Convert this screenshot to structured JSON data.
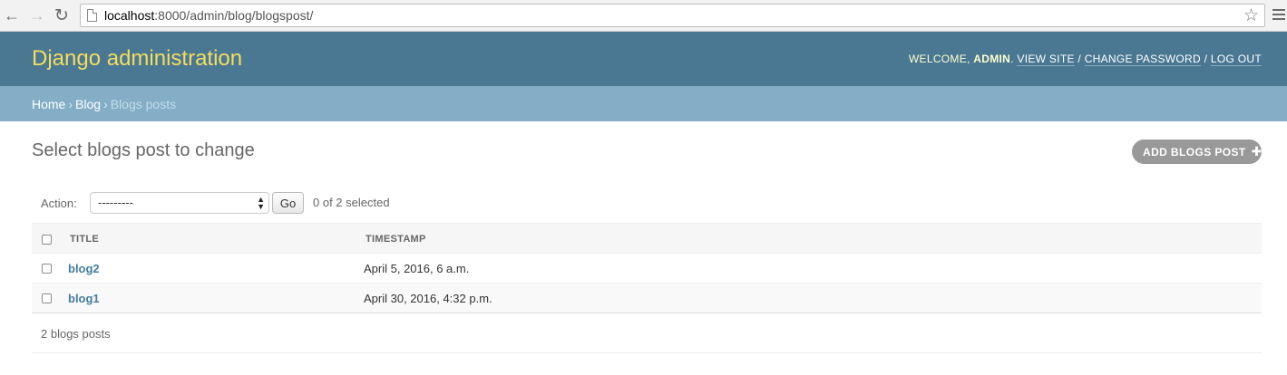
{
  "browser": {
    "url_host": "localhost",
    "url_rest": ":8000/admin/blog/blogspost/",
    "back_icon": "←",
    "forward_icon": "→",
    "reload_icon": "↻",
    "star_icon": "☆"
  },
  "header": {
    "brand": "Django administration",
    "welcome": "WELCOME, ",
    "username": "ADMIN",
    "after_username": ". ",
    "view_site": "VIEW SITE",
    "change_password": "CHANGE PASSWORD",
    "log_out": "LOG OUT",
    "separator": " / "
  },
  "breadcrumbs": {
    "home": "Home",
    "app": "Blog",
    "current": "Blogs posts",
    "arrow": "›"
  },
  "content": {
    "title": "Select blogs post to change",
    "add_button": "ADD BLOGS POST",
    "add_icon": "✚"
  },
  "actions": {
    "label": "Action:",
    "selected_option": "---------",
    "go": "Go",
    "counter": "0 of 2 selected"
  },
  "table": {
    "columns": [
      "TITLE",
      "TIMESTAMP"
    ],
    "rows": [
      {
        "title": "blog2",
        "timestamp": "April 5, 2016, 6 a.m."
      },
      {
        "title": "blog1",
        "timestamp": "April 30, 2016, 4:32 p.m."
      }
    ]
  },
  "paginator": "2 blogs posts",
  "colors": {
    "header_bg": "#4a7893",
    "brand": "#f5dd5d",
    "breadcrumbs_bg": "#83aec6",
    "link": "#447e9b",
    "add_button_bg": "#999999"
  }
}
